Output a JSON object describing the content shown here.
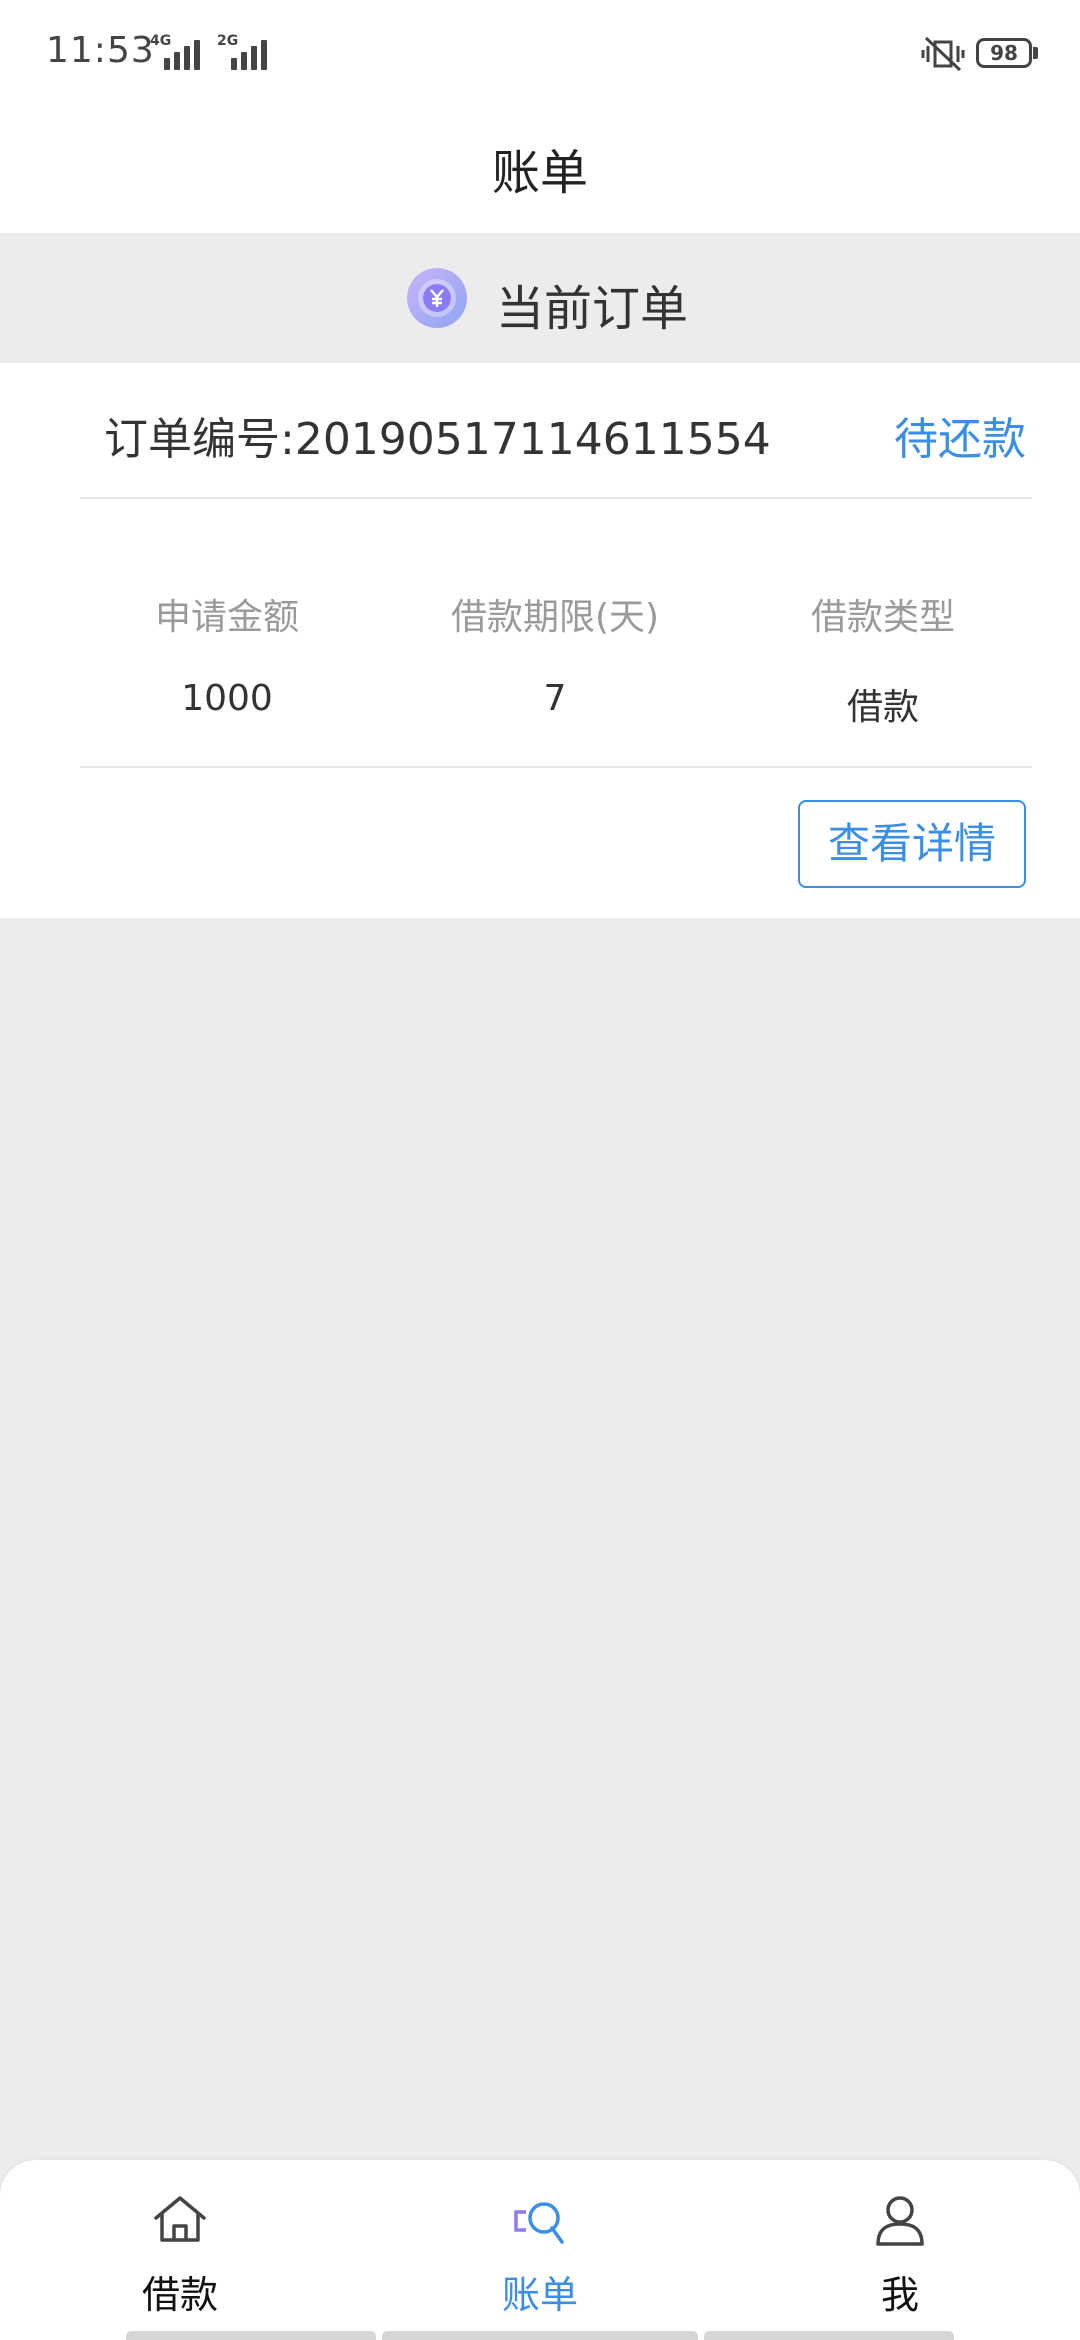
{
  "status_bar": {
    "time": "11:53",
    "network1": "4G",
    "network2": "2G",
    "battery": "98"
  },
  "header": {
    "title": "账单"
  },
  "section": {
    "title": "当前订单"
  },
  "order": {
    "number_label": "订单编号:20190517114611554",
    "status": "待还款",
    "columns": [
      {
        "label": "申请金额",
        "value": "1000"
      },
      {
        "label": "借款期限(天)",
        "value": "7"
      },
      {
        "label": "借款类型",
        "value": "借款"
      }
    ],
    "detail_button": "查看详情"
  },
  "nav": {
    "items": [
      {
        "label": "借款",
        "icon": "home-icon"
      },
      {
        "label": "账单",
        "icon": "bill-search-icon"
      },
      {
        "label": "我",
        "icon": "user-icon"
      }
    ],
    "active": "账单"
  },
  "colors": {
    "accent": "#3a8ee6",
    "background": "#ececec",
    "icon_purple": "#8b7cf6"
  }
}
